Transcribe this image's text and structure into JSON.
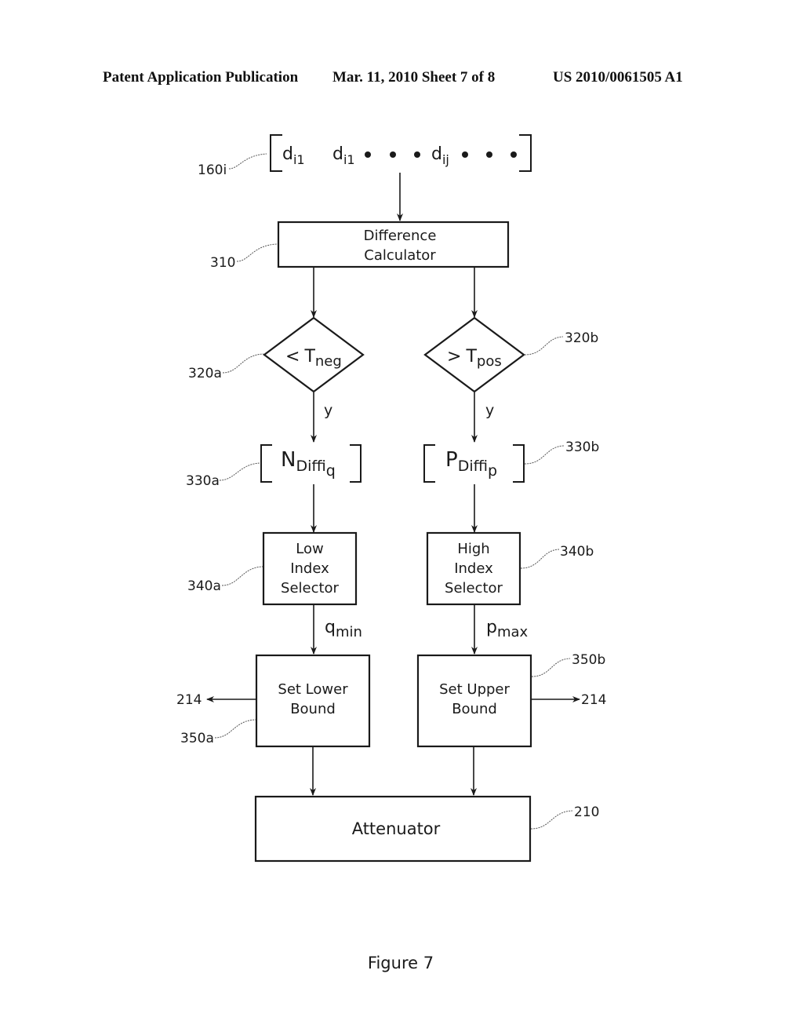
{
  "header": {
    "left": "Patent Application Publication",
    "center": "Mar. 11, 2010  Sheet 7 of 8",
    "right": "US 2010/0061505 A1"
  },
  "vector": {
    "ref": "160i",
    "items": [
      {
        "base": "d",
        "sub": "i1"
      },
      {
        "base": "d",
        "sub": "i1"
      },
      {
        "base": "d",
        "sub": "ij"
      }
    ]
  },
  "difference_calculator": {
    "ref": "310",
    "line1": "Difference",
    "line2": "Calculator"
  },
  "decision_neg": {
    "ref": "320a",
    "op": "<",
    "base": "T",
    "sub": "neg",
    "yes_label": "y"
  },
  "decision_pos": {
    "ref": "320b",
    "op": ">",
    "base": "T",
    "sub": "pos",
    "yes_label": "y"
  },
  "ndiff": {
    "ref": "330a",
    "base": "N",
    "sub": "Diff",
    "subsub": "iq"
  },
  "pdiff": {
    "ref": "330b",
    "base": "P",
    "sub": "Diff",
    "subsub": "ip"
  },
  "low_selector": {
    "ref": "340a",
    "line1": "Low",
    "line2": "Index",
    "line3": "Selector",
    "out_base": "q",
    "out_sub": "min"
  },
  "high_selector": {
    "ref": "340b",
    "line1": "High",
    "line2": "Index",
    "line3": "Selector",
    "out_base": "p",
    "out_sub": "max"
  },
  "lower_bound": {
    "ref": "350a",
    "line1": "Set Lower",
    "line2": "Bound",
    "out_ref": "214"
  },
  "upper_bound": {
    "ref": "350b",
    "line1": "Set Upper",
    "line2": "Bound",
    "out_ref": "214"
  },
  "attenuator": {
    "ref": "210",
    "label": "Attenuator"
  },
  "caption": "Figure 7"
}
